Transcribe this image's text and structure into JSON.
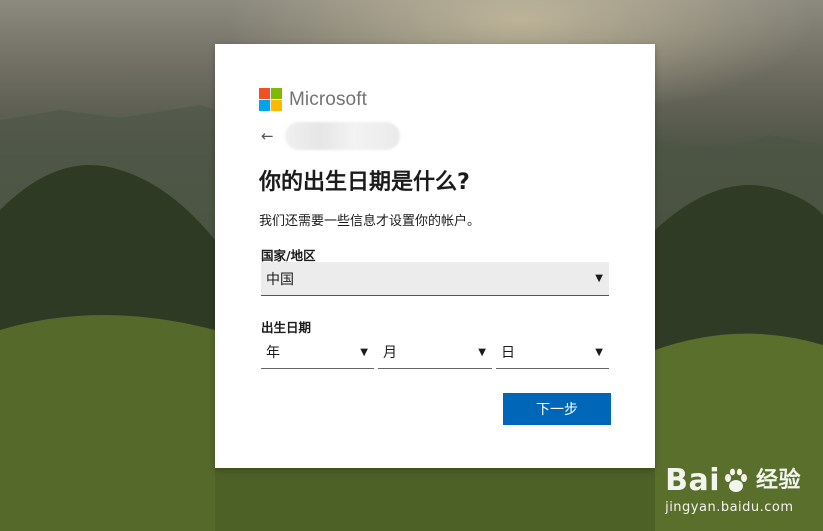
{
  "brand": {
    "name": "Microsoft",
    "colors": {
      "red": "#f25022",
      "green": "#7fba00",
      "blue": "#00a4ef",
      "yellow": "#ffb900"
    }
  },
  "nav": {
    "back_icon": "back-arrow-icon"
  },
  "heading": {
    "title": "你的出生日期是什么?",
    "subtitle": "我们还需要一些信息才设置你的帐户。"
  },
  "form": {
    "country_label": "国家/地区",
    "country_value": "中国",
    "dob_label": "出生日期",
    "year_placeholder": "年",
    "month_placeholder": "月",
    "day_placeholder": "日"
  },
  "actions": {
    "next_label": "下一步",
    "accent": "#0067b8"
  },
  "watermark": {
    "brand_left": "Bai",
    "brand_right": "经验",
    "url": "jingyan.baidu.com"
  }
}
